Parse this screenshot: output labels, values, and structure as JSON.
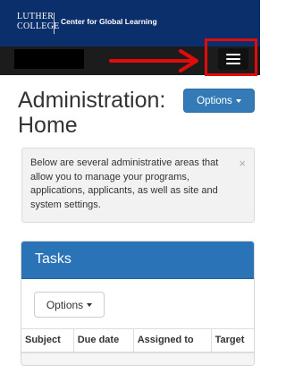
{
  "brand": {
    "logo_line1": "LUTHER",
    "logo_line2": "COLLEGE",
    "name": "Center for Global Learning",
    "bar_color": "#0b2f6b"
  },
  "nav": {
    "menu_icon": "hamburger-menu-icon"
  },
  "annotation": {
    "arrow_color": "#e20b0b"
  },
  "page": {
    "title": "Administration: Home",
    "options_label": "Options"
  },
  "alert": {
    "text": "Below are several administrative areas that allow you to manage your programs, applications, applicants, as well as site and system settings.",
    "close_glyph": "×"
  },
  "tasks": {
    "title": "Tasks",
    "options_label": "Options",
    "columns": [
      "Subject",
      "Due date",
      "Assigned to",
      "Target"
    ],
    "header_color": "#2a73b6"
  }
}
